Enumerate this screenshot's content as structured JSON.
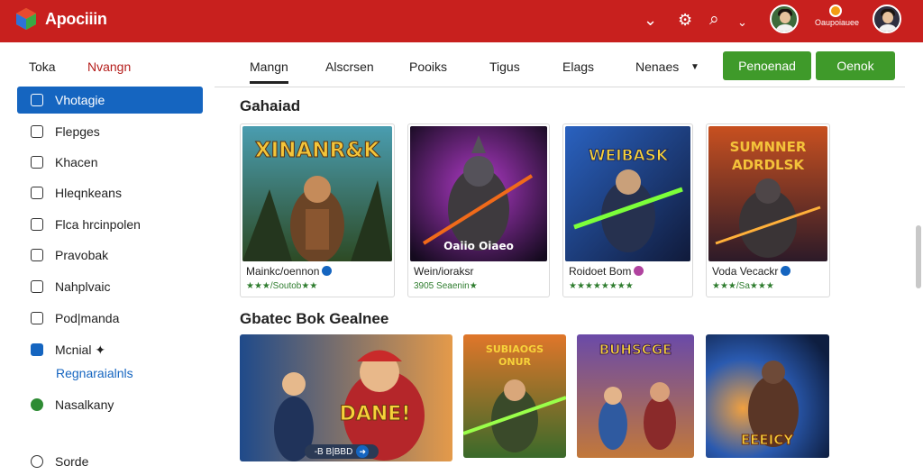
{
  "app": {
    "title": "Apociiin"
  },
  "topbar": {
    "icons": [
      "chevron-down-icon",
      "gear-icon",
      "search-icon",
      "caret-down-icon"
    ],
    "notification_label": "Oaupoiauee"
  },
  "sidebar": {
    "tabs": [
      {
        "label": "Toka"
      },
      {
        "label": "Nvangn"
      }
    ],
    "items": [
      {
        "label": "Vhotagie",
        "active": true
      },
      {
        "label": "Flepges"
      },
      {
        "label": "Khacen"
      },
      {
        "label": "Hleqnkeans"
      },
      {
        "label": "Flca hrcinpolen"
      },
      {
        "label": "Pravobak"
      },
      {
        "label": "Nahplvaic"
      },
      {
        "label": "Pod|manda"
      },
      {
        "label": "Mcnial ✦"
      },
      {
        "label": "Nasalkany"
      },
      {
        "label": "Sorde"
      }
    ],
    "sub_link": "Regnaraialnls"
  },
  "main": {
    "tabs": [
      {
        "label": "Mangn",
        "active": true
      },
      {
        "label": "Alscrsen"
      },
      {
        "label": "Pooiks"
      },
      {
        "label": "Tigus"
      },
      {
        "label": "Elags"
      },
      {
        "label": "Nenaes"
      }
    ],
    "buttons": [
      {
        "label": "Penoenad"
      },
      {
        "label": "Oenok"
      }
    ],
    "section1": {
      "title": "Gahaiad",
      "cards": [
        {
          "art_text": "XINANR&K",
          "name": "Mainkc/oennon",
          "rating": "★★★/Soutob★★"
        },
        {
          "art_text": "Oaiio Oiaeo",
          "name": "Wein/ioraksr",
          "rating": "3905 Seaenin★"
        },
        {
          "art_text": "WEIBASK",
          "name": "Roidoet Bom",
          "rating": "★★★★★★★★"
        },
        {
          "art_text": "SUMNNER ADRDLSK",
          "name": "Voda Vecackr",
          "rating": "★★★/Sa★★★"
        }
      ]
    },
    "section2": {
      "title": "Gbatec Bok Gealnee",
      "cards": [
        {
          "art_text": "DANE!"
        },
        {
          "art_text": "SUBIAOGS ONUR"
        },
        {
          "art_text": "BUHSCGE"
        },
        {
          "art_text": "EEEICY"
        }
      ],
      "pill_label": "-B B|BBD"
    }
  },
  "colors": {
    "topbar": "#c8201e",
    "accent": "#1565c0",
    "button": "#3f9a2a"
  }
}
